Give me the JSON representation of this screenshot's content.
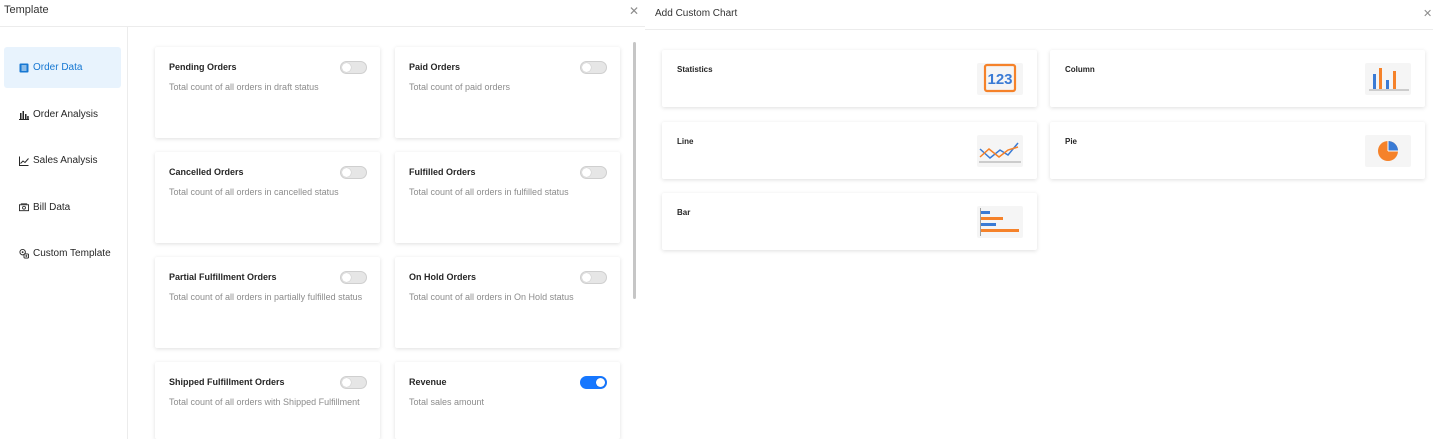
{
  "left_panel": {
    "title": "Template",
    "sidebar": [
      {
        "label": "Order Data",
        "icon": "list-icon",
        "active": true
      },
      {
        "label": "Order Analysis",
        "icon": "bar-chart-icon",
        "active": false
      },
      {
        "label": "Sales Analysis",
        "icon": "line-chart-icon",
        "active": false
      },
      {
        "label": "Bill Data",
        "icon": "bill-icon",
        "active": false
      },
      {
        "label": "Custom Template",
        "icon": "custom-template-icon",
        "active": false
      }
    ],
    "cards": [
      {
        "title": "Pending Orders",
        "desc": "Total count of all orders in draft status",
        "enabled": false
      },
      {
        "title": "Paid Orders",
        "desc": "Total count of paid orders",
        "enabled": false
      },
      {
        "title": "Cancelled Orders",
        "desc": "Total count of all orders in cancelled status",
        "enabled": false
      },
      {
        "title": "Fulfilled Orders",
        "desc": "Total count of all orders in fulfilled status",
        "enabled": false
      },
      {
        "title": "Partial Fulfillment Orders",
        "desc": "Total count of all orders in partially fulfilled status",
        "enabled": false
      },
      {
        "title": "On Hold Orders",
        "desc": "Total count of all orders in On Hold status",
        "enabled": false
      },
      {
        "title": "Shipped Fulfillment Orders",
        "desc": "Total count of all orders with Shipped Fulfillment",
        "enabled": false
      },
      {
        "title": "Revenue",
        "desc": "Total sales amount",
        "enabled": true
      }
    ]
  },
  "right_panel": {
    "title": "Add Custom Chart",
    "charts": [
      {
        "label": "Statistics",
        "icon": "statistics-123-icon"
      },
      {
        "label": "Column",
        "icon": "column-chart-icon"
      },
      {
        "label": "Line",
        "icon": "line-chart-icon"
      },
      {
        "label": "Pie",
        "icon": "pie-chart-icon"
      },
      {
        "label": "Bar",
        "icon": "bar-chart-icon"
      }
    ],
    "statistics_icon_text": "123"
  },
  "colors": {
    "accent": "#1677d2",
    "active_bg": "#e8f3fd",
    "toggle_on": "#1677ff",
    "chart_orange": "#f5822a",
    "chart_blue": "#3a7bd5"
  }
}
